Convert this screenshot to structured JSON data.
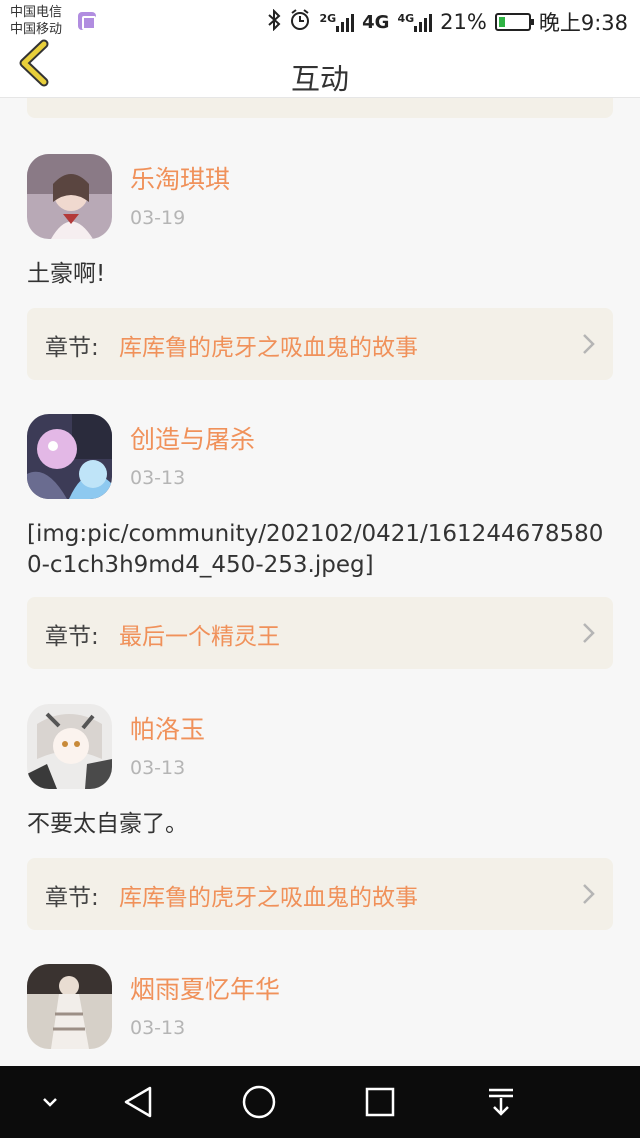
{
  "status_bar": {
    "carrier_1": "中国电信",
    "carrier_2": "中国移动",
    "net_small_1": "2G",
    "net_big": "4G",
    "net_small_2": "4G",
    "battery_percent": "21%",
    "time": "晚上9:38",
    "battery_level": 0.21
  },
  "header": {
    "title": "互动"
  },
  "chapter_prefix": "章节:",
  "posts": [
    {
      "username": "乐淘琪琪",
      "date": "03-19",
      "content": "土豪啊!",
      "chapter": "库库鲁的虎牙之吸血鬼的故事"
    },
    {
      "username": "创造与屠杀",
      "date": "03-13",
      "content": "[img:pic/community/202102/0421/1612446785800-c1ch3h9md4_450-253.jpeg]",
      "chapter": "最后一个精灵王"
    },
    {
      "username": "帕洛玉",
      "date": "03-13",
      "content": "不要太自豪了。",
      "chapter": "库库鲁的虎牙之吸血鬼的故事"
    },
    {
      "username": "烟雨夏忆年华",
      "date": "03-13"
    }
  ],
  "colors": {
    "accent": "#f0915a",
    "date": "#b5b5b5",
    "chapter_bg": "#f3f0e8",
    "back_arrow": "#e8cf3b",
    "navbar": "#0c0c0c"
  }
}
